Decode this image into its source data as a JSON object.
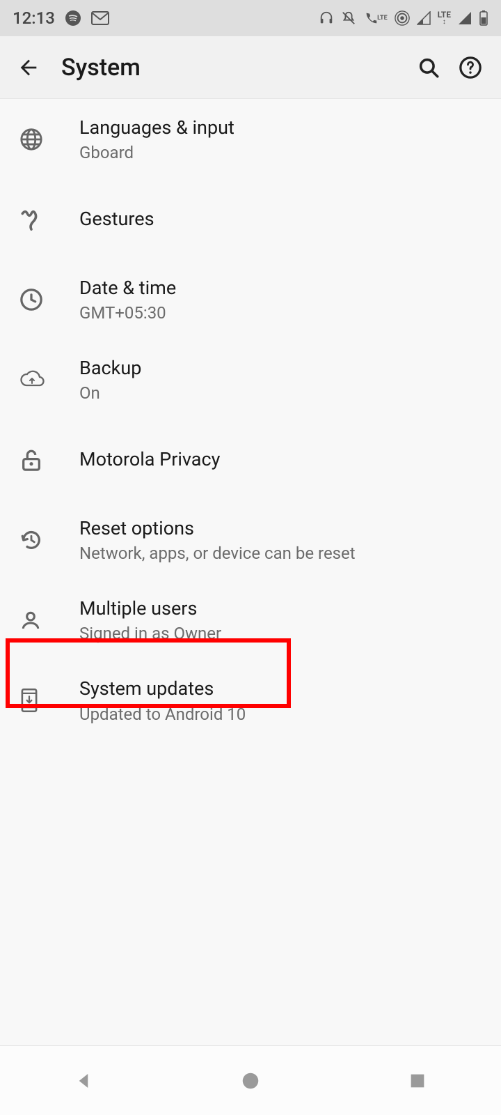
{
  "status": {
    "time": "12:13",
    "lte": "LTE"
  },
  "header": {
    "title": "System"
  },
  "items": [
    {
      "title": "Languages & input",
      "sub": "Gboard"
    },
    {
      "title": "Gestures",
      "sub": ""
    },
    {
      "title": "Date & time",
      "sub": "GMT+05:30"
    },
    {
      "title": "Backup",
      "sub": "On"
    },
    {
      "title": "Motorola Privacy",
      "sub": ""
    },
    {
      "title": "Reset options",
      "sub": "Network, apps, or device can be reset"
    },
    {
      "title": "Multiple users",
      "sub": "Signed in as Owner"
    },
    {
      "title": "System updates",
      "sub": "Updated to Android 10"
    }
  ]
}
